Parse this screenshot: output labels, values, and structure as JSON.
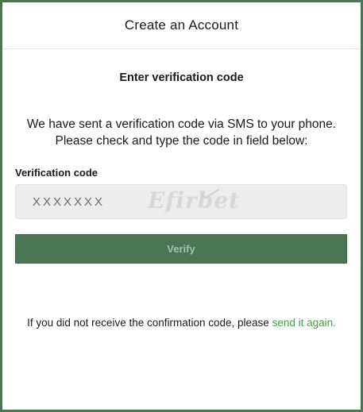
{
  "header": {
    "title": "Create an Account"
  },
  "verification": {
    "subtitle": "Enter verification code",
    "message_line1": "We have sent a verification code via SMS to your phone.",
    "message_line2": "Please check and type the code in field below:",
    "field_label": "Verification code",
    "input_placeholder": "XXXXXXX",
    "input_value": "",
    "watermark_text": "Efirbet",
    "verify_label": "Verify"
  },
  "resend": {
    "prefix": "If you did not receive the confirmation code, please ",
    "link_label": "send it again."
  },
  "colors": {
    "brand_green": "#4a7655",
    "link_green": "#46a049",
    "frame_border": "#4b7452",
    "input_bg": "#ececec"
  }
}
